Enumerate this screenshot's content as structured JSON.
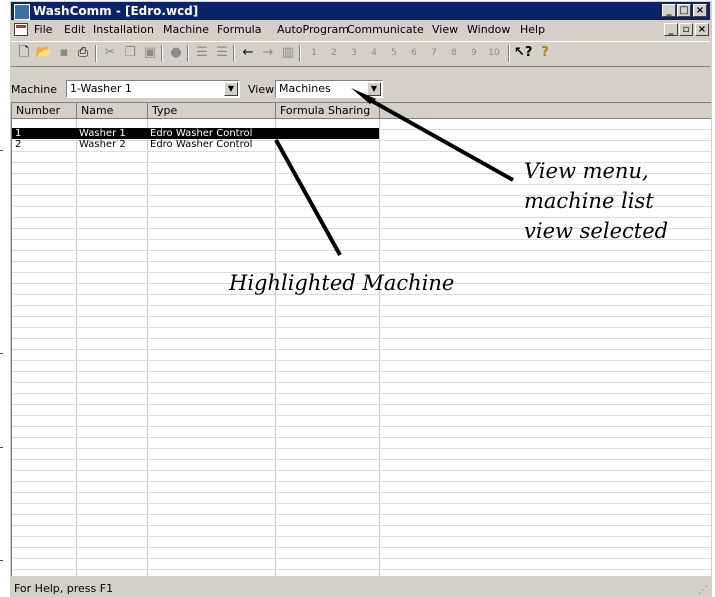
{
  "window": {
    "title": "WashComm - [Edro.wcd]"
  },
  "menu": [
    "File",
    "Edit",
    "Installation",
    "Machine",
    "Formula",
    "AutoProgram",
    "Communicate",
    "View",
    "Window",
    "Help"
  ],
  "selector": {
    "machine_label": "Machine",
    "machine_value": "1-Washer 1",
    "view_label": "View",
    "view_value": "Machines"
  },
  "grid": {
    "columns": [
      "Number",
      "Name",
      "Type",
      "Formula Sharing"
    ],
    "rows": [
      {
        "number": "1",
        "name": "Washer 1",
        "type": "Edro Washer Control",
        "sharing": ""
      },
      {
        "number": "2",
        "name": "Washer 2",
        "type": "Edro Washer Control",
        "sharing": ""
      }
    ]
  },
  "status": {
    "text": "For Help, press F1"
  },
  "annotations": {
    "view_menu": [
      "View menu,",
      "machine list",
      "view selected"
    ],
    "highlighted": "Highlighted Machine"
  }
}
